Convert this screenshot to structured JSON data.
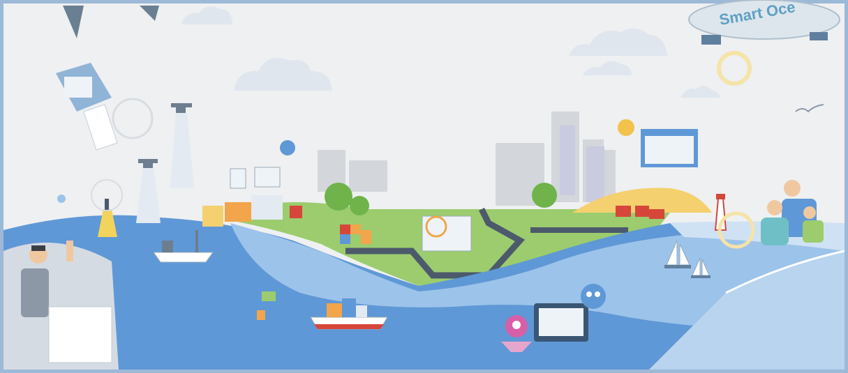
{
  "blimp": {
    "label": "Smart Oce"
  },
  "colors": {
    "sky": "#eef0f1",
    "frame": "#9db9d8",
    "sea_dark": "#5f98d6",
    "sea_light": "#9cc3ea",
    "land_green": "#9ccc6e",
    "tree_green": "#6fb34a",
    "crane_red": "#d6463a",
    "sand": "#f4d06f",
    "city_grey": "#cfd2d6",
    "cloud": "#dfe6ee",
    "accent_orange": "#f2a54a"
  },
  "icons": {
    "scene": "smart-ocean-illustration",
    "drones": "drone-icon",
    "buoy": "buoy-icon",
    "lighthouse": "lighthouse-icon",
    "sailboats": "sailboat-icon",
    "cargo_ship": "cargo-ship-icon",
    "map_pin": "location-pin-icon",
    "mascot": "mascot-icon"
  }
}
